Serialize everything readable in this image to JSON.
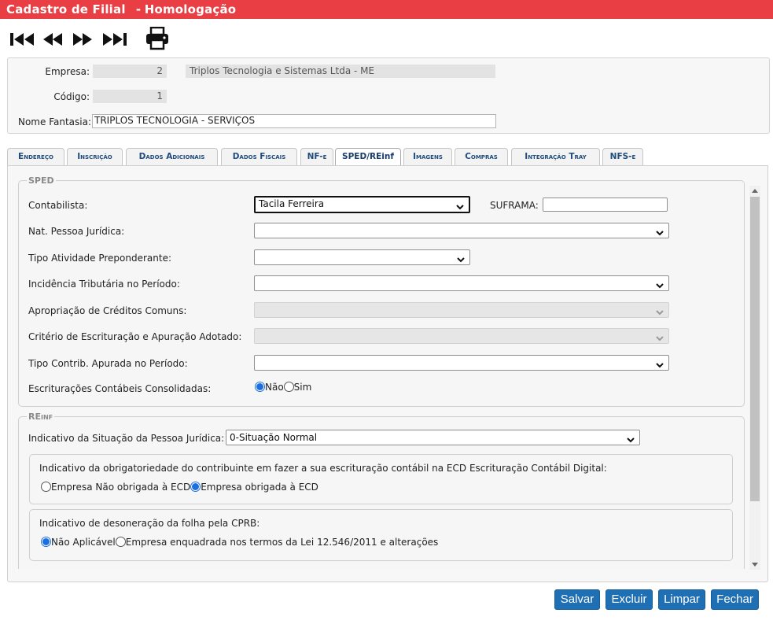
{
  "app": {
    "title_part1": "Cadastro de Filial",
    "title_sep": "-",
    "title_part2": "Homologação"
  },
  "toolbar": {
    "icons": [
      "first-record-icon",
      "previous-record-icon",
      "next-record-icon",
      "last-record-icon",
      "printer-icon"
    ]
  },
  "header": {
    "empresa_label": "Empresa:",
    "empresa_code": "2",
    "empresa_name": "Triplos Tecnologia e Sistemas Ltda - ME",
    "codigo_label": "Código:",
    "codigo_value": "1",
    "fantasia_label": "Nome Fantasia:",
    "fantasia_value": "TRIPLOS TECNOLOGIA - SERVIÇOS"
  },
  "tabs": [
    {
      "label": "Endereço"
    },
    {
      "label": "Inscrição"
    },
    {
      "label": "Dados Adicionais"
    },
    {
      "label": "Dados Fiscais"
    },
    {
      "label": "NF-e"
    },
    {
      "label": "SPED/REinf",
      "active": true
    },
    {
      "label": "Imagens"
    },
    {
      "label": "Compras"
    },
    {
      "label": "Integração Tray"
    },
    {
      "label": "NFS-e"
    }
  ],
  "sped": {
    "legend": "SPED",
    "contabilista_label": "Contabilista:",
    "contabilista_value": "Tacila Ferreira",
    "suframa_label": "SUFRAMA:",
    "suframa_value": "",
    "nat_label": "Nat. Pessoa Jurídica:",
    "nat_value": "",
    "tipo_ativ_label": "Tipo Atividade Preponderante:",
    "tipo_ativ_value": "",
    "incid_label": "Incidência Tributária no Período:",
    "incid_value": "",
    "aprop_label": "Apropriação de Créditos Comuns:",
    "aprop_value": "",
    "criterio_label": "Critério de Escrituração e Apuração Adotado:",
    "criterio_value": "",
    "tipo_contrib_label": "Tipo Contrib. Apurada no Período:",
    "tipo_contrib_value": "",
    "escrit_label": "Escriturações Contábeis Consolidadas:",
    "escrit_opt1": "Não",
    "escrit_opt2": "Sim",
    "escrit_selected": "Não"
  },
  "reinf": {
    "legend": "REinf",
    "situacao_label": "Indicativo da Situação da Pessoa Jurídica:",
    "situacao_value": "0-Situação Normal",
    "ecd_title": "Indicativo da obrigatoriedade do contribuinte em fazer a sua escrituração contábil na ECD Escrituração Contábil Digital:",
    "ecd_opt1": "Empresa Não obrigada à ECD",
    "ecd_opt2": "Empresa obrigada à ECD",
    "ecd_selected": "Empresa obrigada à ECD",
    "cprb_title": "Indicativo de desoneração da folha pela CPRB:",
    "cprb_opt1": "Não Aplicável",
    "cprb_opt2": "Empresa enquadrada nos termos da Lei 12.546/2011 e alterações",
    "cprb_selected": "Não Aplicável"
  },
  "buttons": {
    "save": "Salvar",
    "delete": "Excluir",
    "clear": "Limpar",
    "close": "Fechar"
  },
  "colors": {
    "title_bar": "#e93f44",
    "tab_text": "#1f4b7d",
    "button": "#1f6fb4",
    "radio_selected": "#1a6ee0"
  }
}
